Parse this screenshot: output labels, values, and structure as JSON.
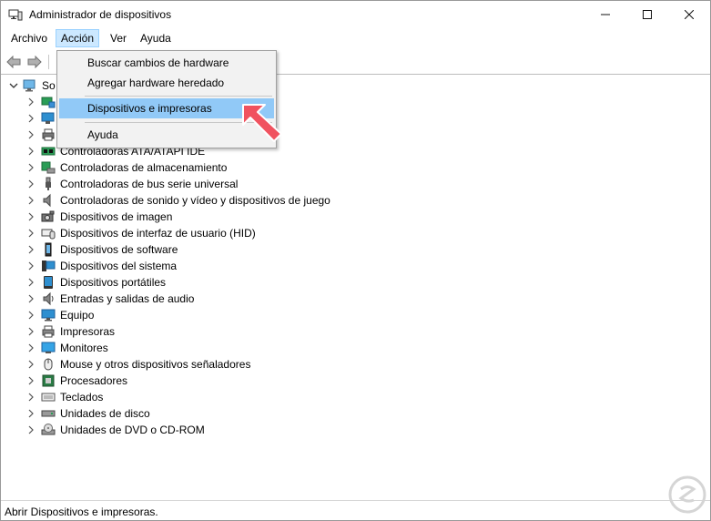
{
  "window": {
    "title": "Administrador de dispositivos",
    "controls": [
      "minimize-icon",
      "maximize-icon",
      "close-icon"
    ]
  },
  "menubar": {
    "items": [
      "Archivo",
      "Acción",
      "Ver",
      "Ayuda"
    ],
    "active": "Acción"
  },
  "dropdown": {
    "items": [
      {
        "label": "Buscar cambios de hardware"
      },
      {
        "label": "Agregar hardware heredado"
      },
      {
        "label": "Dispositivos e impresoras",
        "highlighted": true
      },
      {
        "label": "Ayuda"
      }
    ]
  },
  "tree": {
    "root_label_visible": "So",
    "categories": [
      "Controladoras ATA/ATAPI IDE",
      "Controladoras de almacenamiento",
      "Controladoras de bus serie universal",
      "Controladoras de sonido y vídeo y dispositivos de juego",
      "Dispositivos de imagen",
      "Dispositivos de interfaz de usuario (HID)",
      "Dispositivos de software",
      "Dispositivos del sistema",
      "Dispositivos portátiles",
      "Entradas y salidas de audio",
      "Equipo",
      "Impresoras",
      "Monitores",
      "Mouse y otros dispositivos señaladores",
      "Procesadores",
      "Teclados",
      "Unidades de disco",
      "Unidades de DVD o CD-ROM"
    ],
    "hidden_rows_icons": [
      "network-adapter-icon",
      "display-adapter-icon",
      "printer-queue-icon"
    ]
  },
  "statusbar": {
    "text": "Abrir Dispositivos e impresoras."
  },
  "colors": {
    "menu_highlight": "#91c9f7",
    "menu_active_bg": "#cce8ff",
    "annotation_arrow": "#f0525f"
  }
}
